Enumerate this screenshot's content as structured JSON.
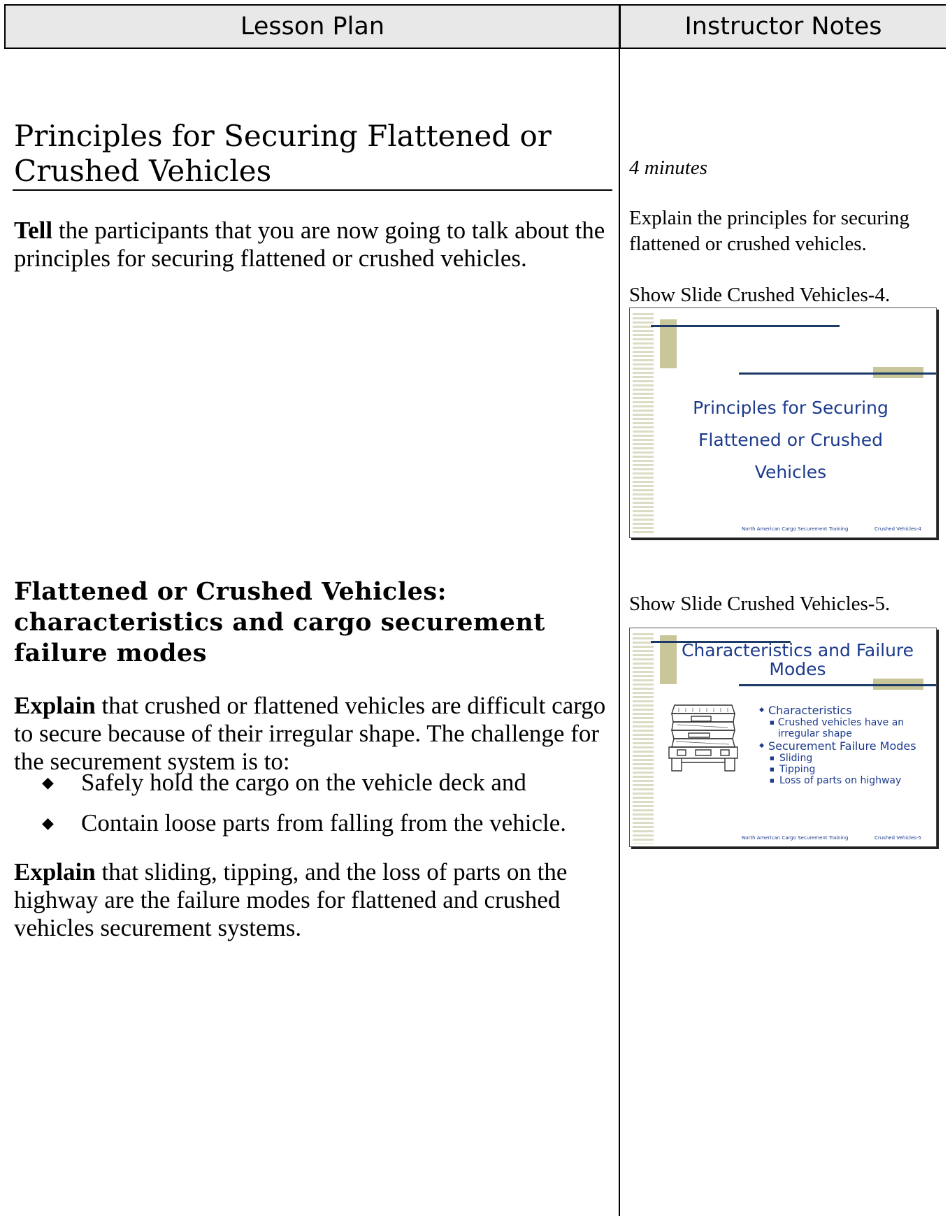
{
  "header": {
    "left": "Lesson Plan",
    "right": "Instructor Notes"
  },
  "lesson": {
    "section_title": "Principles for Securing Flattened or Crushed Vehicles",
    "p1_bold": "Tell",
    "p1_text": " the participants that you are now going to talk about the principles for securing flattened or crushed vehicles.",
    "subheading": "Flattened or Crushed Vehicles: characteristics and cargo securement failure modes",
    "p2_bold": "Explain",
    "p2_text": " that crushed or flattened vehicles are difficult cargo to secure because of their irregular shape.  The challenge for the securement system is to:",
    "bullets": [
      "Safely hold the cargo on the vehicle deck and",
      "Contain loose parts from falling from the vehicle."
    ],
    "p3_bold": "Explain",
    "p3_text": " that sliding, tipping, and the loss of parts on the highway are the failure modes for flattened and crushed vehicles securement systems."
  },
  "notes": {
    "minutes": "4 minutes",
    "explain": "Explain the principles for securing flattened or crushed vehicles.",
    "show4": "Show Slide Crushed Vehicles-4.",
    "show5": "Show Slide Crushed Vehicles-5."
  },
  "slide4": {
    "title_l1": "Principles for Securing",
    "title_l2": "Flattened or Crushed",
    "title_l3": "Vehicles",
    "footer_left": "North American Cargo Securement Training",
    "footer_right": "Crushed Vehicles-4"
  },
  "slide5": {
    "title_l1": "Characteristics and Failure",
    "title_l2": "Modes",
    "b1": "Characteristics",
    "b1_sub": "Crushed vehicles have an irregular shape",
    "b2": "Securement Failure Modes",
    "b2_sub": [
      "Sliding",
      "Tipping",
      "Loss of parts on highway"
    ],
    "footer_left": "North American Cargo Securement Training",
    "footer_right": "Crushed Vehicles-5"
  },
  "colors": {
    "slide_text": "#1c3a8c",
    "slide_tan": "#c9c69a",
    "slide_navy": "#1c3a66",
    "header_bg": "#e8e8e8"
  }
}
